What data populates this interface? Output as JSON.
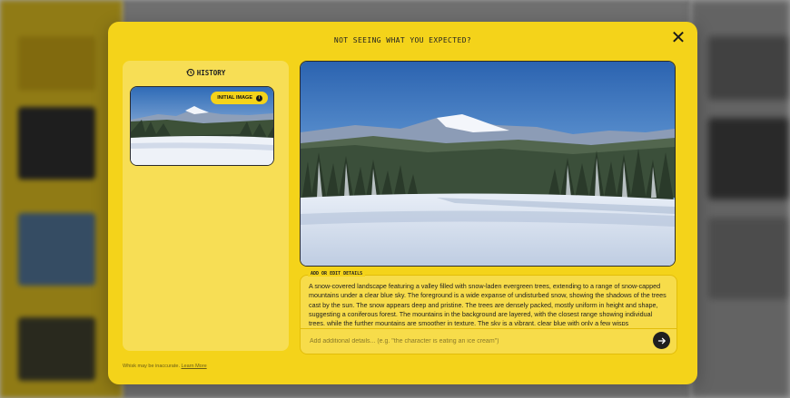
{
  "modal": {
    "title": "NOT SEEING WHAT YOU EXPECTED?",
    "close_icon": "close-icon",
    "accent_color": "#f4d31a"
  },
  "history": {
    "heading": "HISTORY",
    "icon": "history-icon",
    "items": [
      {
        "badge": "INITIAL IMAGE",
        "badge_icon": "info-icon"
      }
    ]
  },
  "details": {
    "label": "ADD OR EDIT DETAILS",
    "text": "A snow-covered landscape featuring a valley filled with snow-laden evergreen trees, extending to a range of snow-capped mountains under a clear blue sky. The foreground is a wide expanse of undisturbed snow, showing the shadows of the trees cast by the sun. The snow appears deep and pristine. The trees are densely packed, mostly uniform in height and shape, suggesting a coniferous forest. The mountains in the background are layered, with the closest range showing individual trees, while the further mountains are smoother in texture. The sky is a vibrant, clear blue with only a few wisps",
    "input_placeholder": "Add additional details... (e.g. \"the character is eating an ice cream\")",
    "send_icon": "arrow-right-icon"
  },
  "footer": {
    "disclaimer": "Whisk may be inaccurate.",
    "link": "Learn More"
  }
}
